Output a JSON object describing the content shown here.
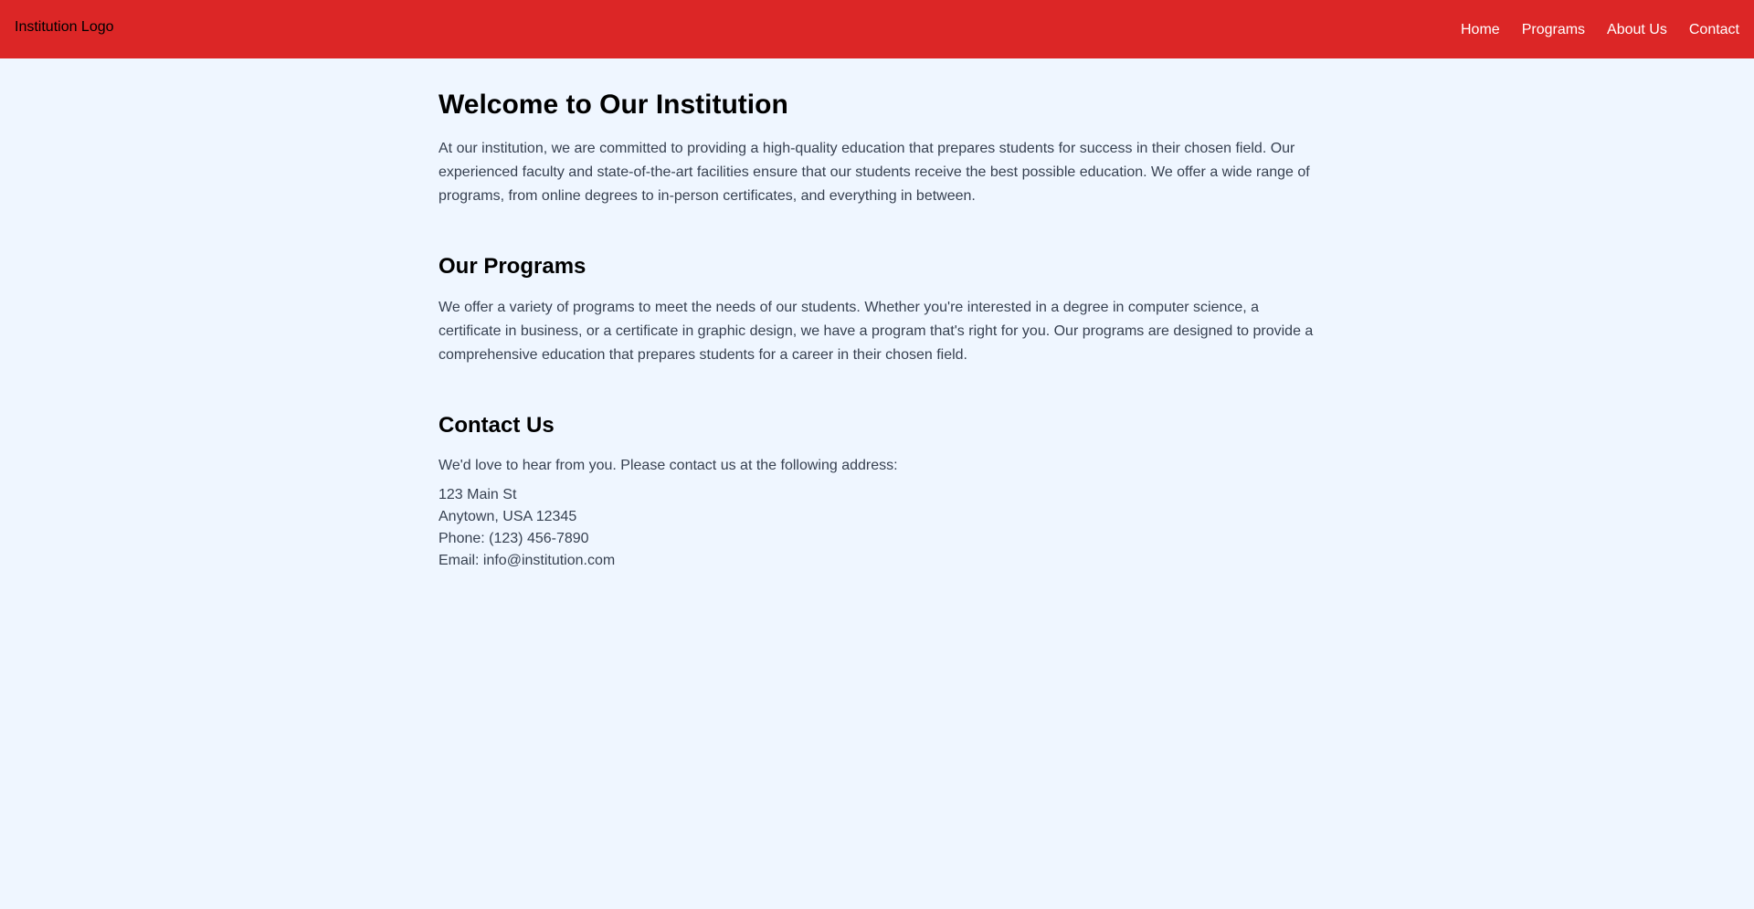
{
  "header": {
    "logo": "Institution Logo",
    "nav": [
      "Home",
      "Programs",
      "About Us",
      "Contact"
    ],
    "background": "#dc2626"
  },
  "welcome": {
    "title": "Welcome to Our Institution",
    "text": "At our institution, we are committed to providing a high-quality education that prepares students for success in their chosen field. Our experienced faculty and state-of-the-art facilities ensure that our students receive the best possible education. We offer a wide range of programs, from online degrees to in-person certificates, and everything in between."
  },
  "programs": {
    "title": "Our Programs",
    "text": "We offer a variety of programs to meet the needs of our students. Whether you're interested in a degree in computer science, a certificate in business, or a certificate in graphic design, we have a program that's right for you. Our programs are designed to provide a comprehensive education that prepares students for a career in their chosen field."
  },
  "contact": {
    "title": "Contact Us",
    "text": "We'd love to hear from you. Please contact us at the following address:",
    "address_lines": [
      "123 Main St",
      "Anytown, USA 12345",
      "Phone: (123) 456-7890",
      "Email: info@institution.com"
    ]
  }
}
